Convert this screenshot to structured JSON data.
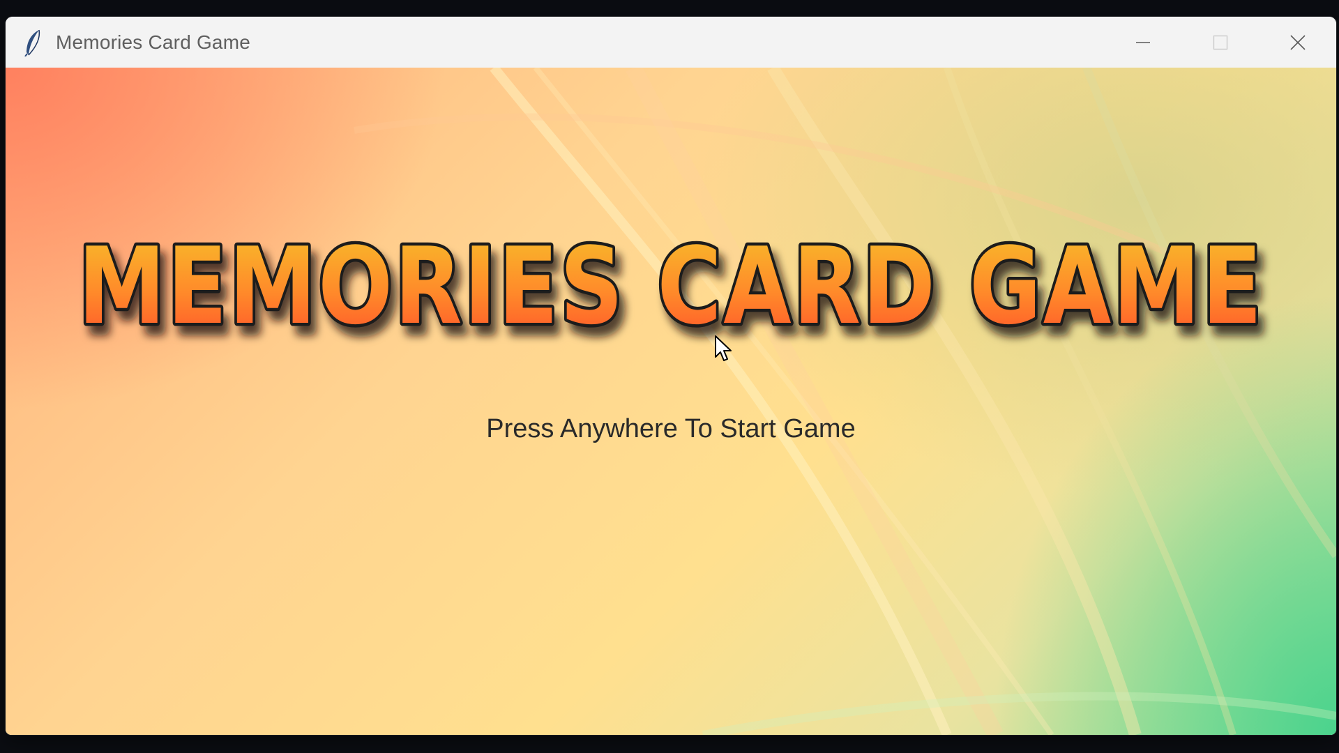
{
  "window": {
    "title": "Memories Card Game",
    "app_icon": "feather-icon",
    "controls": {
      "minimize_icon": "minimize-icon",
      "maximize_icon": "maximize-icon",
      "close_icon": "close-icon"
    }
  },
  "game": {
    "title": "MEMORIES CARD GAME",
    "start_prompt": "Press Anywhere To Start Game"
  },
  "colors": {
    "title_fill_top": "#f7b52a",
    "title_fill_bottom": "#ff4f2a",
    "title_outline": "#1b1b1b",
    "prompt_text": "#2a2a2a",
    "titlebar_bg": "#f3f3f3"
  }
}
